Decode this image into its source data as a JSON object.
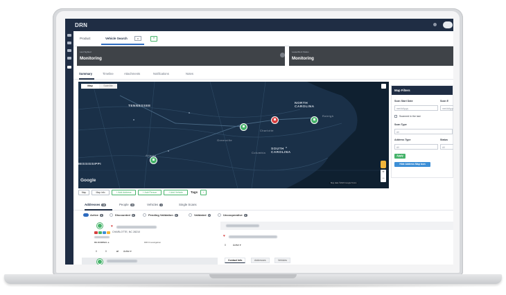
{
  "app": {
    "logo_text": "DRN"
  },
  "product": {
    "label": "Product",
    "tab": "Vehicle Search",
    "tab_select": "v",
    "add": "+"
  },
  "cards": [
    {
      "small": "Last Sighted",
      "big": "Monitoring"
    },
    {
      "small": "Lease/Rent Status",
      "big": "Monitoring"
    }
  ],
  "tabs": [
    {
      "label": "Summary",
      "active": true
    },
    {
      "label": "Timeline",
      "active": false
    },
    {
      "label": "Attachments",
      "active": false
    },
    {
      "label": "Notifications",
      "active": false
    },
    {
      "label": "Notes",
      "active": false
    }
  ],
  "map": {
    "toggle": [
      "Map",
      "Satellite"
    ],
    "labels": {
      "tn": "TENNESSEE",
      "nc": "NORTH\nCAROLINA",
      "sc": "SOUTH\nCAROLINA",
      "ms": "MISSISSIPPI",
      "atl": "Atlanta",
      "charlotte": "Charlotte",
      "raleigh": "Raleigh",
      "greenville": "Greenville",
      "columbia": "Columbia"
    },
    "google": "Google",
    "attribution": "Map data ©2023 Google  Terms",
    "zoom_in": "+",
    "zoom_out": "−"
  },
  "filters": {
    "title": "Map Filters",
    "scan_start_label": "Scan Start Date",
    "scan_end_label": "Scan E",
    "date_placeholder": "mm/dd/yyyy",
    "scanned_last": "Scanned in the last",
    "scan_type_label": "Scan Type",
    "scan_type_value": "All",
    "address_type_label": "Address Type",
    "address_type_value": "All",
    "status_label": "Status",
    "status_value": "All",
    "apply": "Apply",
    "hide_address": "Hide Address Map Icon"
  },
  "map_toolbar": {
    "map": "Map",
    "map_info": "Map info",
    "add_address": "+ Add Address",
    "add_person": "+ Add Person",
    "add_vehicle": "+ Add Vehicle",
    "tags": "Tags",
    "tags_add": "+"
  },
  "entity_tabs": [
    {
      "label": "Addresses",
      "count": "18",
      "active": true
    },
    {
      "label": "People",
      "count": "18",
      "active": false
    },
    {
      "label": "Vehicles",
      "count": "2",
      "active": false
    },
    {
      "label": "Single Scans",
      "count": "",
      "active": false
    }
  ],
  "status_filters": [
    {
      "label": "Active",
      "count": "6"
    },
    {
      "label": "Discounted",
      "count": "0"
    },
    {
      "label": "Pending Validation",
      "count": "0"
    },
    {
      "label": "Validated",
      "count": "0"
    },
    {
      "label": "Uncooperative",
      "count": "0"
    }
  ],
  "result": {
    "address": "CHARLOTTE, NC 28210",
    "tag1": "RE-NOMINAL ▸",
    "tag2": "DRN Investigation",
    "count1": "0",
    "count2": "0",
    "status": "Active ▾",
    "right_status": "Active ▾"
  },
  "contact_tabs": [
    "Contact Info",
    "Addresses",
    "Vehicles"
  ],
  "colors": {
    "navy": "#1f2d44",
    "green": "#46b36a",
    "red": "#d64040",
    "blue": "#3d8fd6"
  }
}
